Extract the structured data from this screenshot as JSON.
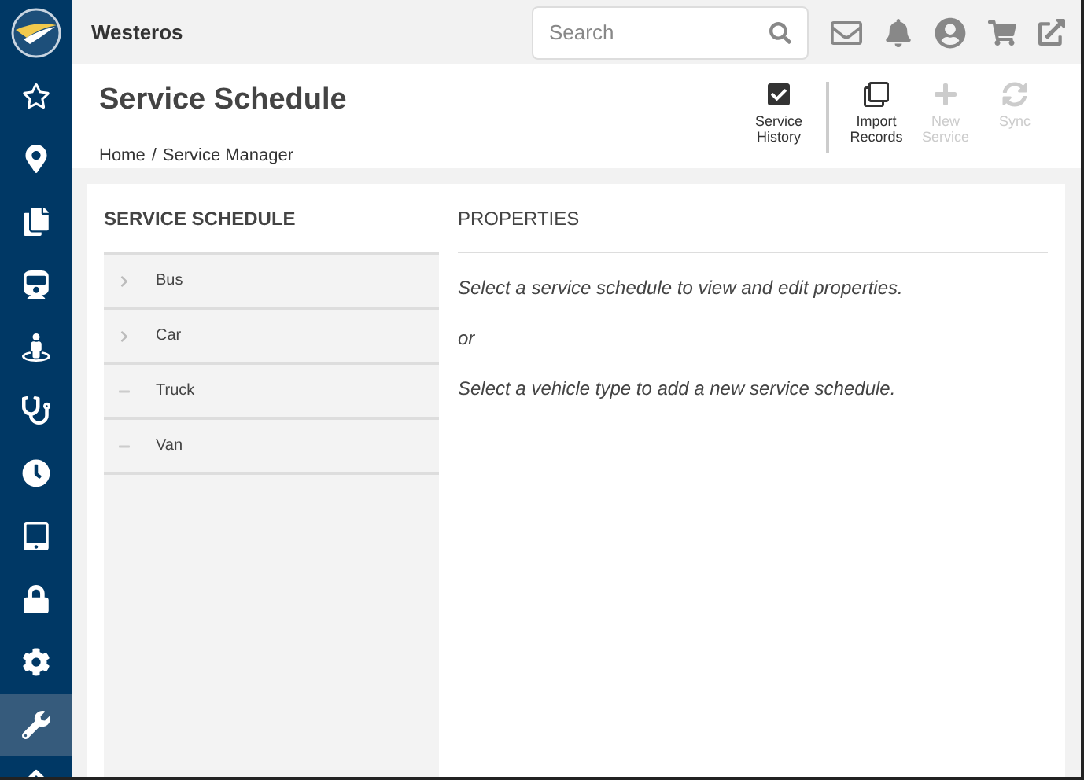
{
  "header": {
    "title": "Westeros",
    "search": {
      "placeholder": "Search"
    }
  },
  "sidebar": {
    "items": [
      {
        "selected": false
      },
      {
        "selected": false
      },
      {
        "selected": false
      },
      {
        "selected": false
      },
      {
        "selected": false
      },
      {
        "selected": false
      },
      {
        "selected": false
      },
      {
        "selected": false
      },
      {
        "selected": false
      },
      {
        "selected": false
      },
      {
        "selected": true
      },
      {
        "selected": false
      }
    ]
  },
  "page": {
    "title": "Service Schedule",
    "breadcrumb": {
      "items": [
        "Home",
        "Service Manager"
      ],
      "separator": "/"
    }
  },
  "toolbar": [
    {
      "label": "Service History",
      "disabled": false
    },
    {
      "label": "Import Records",
      "disabled": false
    },
    {
      "label": "New Service",
      "disabled": true
    },
    {
      "label": "Sync",
      "disabled": true
    }
  ],
  "schedule": {
    "heading": "SERVICE SCHEDULE",
    "items": [
      {
        "label": "Bus",
        "kind": "expandable"
      },
      {
        "label": "Car",
        "kind": "expandable"
      },
      {
        "label": "Truck",
        "kind": "leaf"
      },
      {
        "label": "Van",
        "kind": "leaf"
      }
    ]
  },
  "properties": {
    "heading": "PROPERTIES",
    "lines": [
      "Select a service schedule to view and edit properties.",
      "or",
      "Select a vehicle type to add a new service schedule."
    ]
  }
}
